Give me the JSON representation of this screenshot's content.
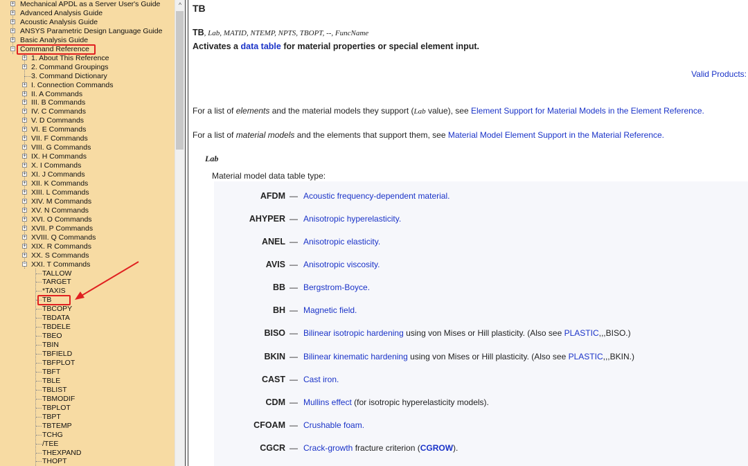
{
  "tree": {
    "items": [
      {
        "label": "Mechanical APDL as a Server User's Guide",
        "level": 0,
        "expander": "+"
      },
      {
        "label": "Advanced Analysis Guide",
        "level": 0,
        "expander": "+"
      },
      {
        "label": "Acoustic Analysis Guide",
        "level": 0,
        "expander": "+"
      },
      {
        "label": "ANSYS Parametric Design Language Guide",
        "level": 0,
        "expander": "+"
      },
      {
        "label": "Basic Analysis Guide",
        "level": 0,
        "expander": "+"
      },
      {
        "label": "Command Reference",
        "level": 0,
        "expander": "-",
        "highlight": true
      },
      {
        "label": "1. About This Reference",
        "level": 1,
        "expander": "+"
      },
      {
        "label": "2. Command Groupings",
        "level": 1,
        "expander": "+"
      },
      {
        "label": "3. Command Dictionary",
        "level": 1,
        "expander": ""
      },
      {
        "label": "I. Connection Commands",
        "level": 1,
        "expander": "+"
      },
      {
        "label": "II. A Commands",
        "level": 1,
        "expander": "+"
      },
      {
        "label": "III. B Commands",
        "level": 1,
        "expander": "+"
      },
      {
        "label": "IV. C Commands",
        "level": 1,
        "expander": "+"
      },
      {
        "label": "V. D Commands",
        "level": 1,
        "expander": "+"
      },
      {
        "label": "VI. E Commands",
        "level": 1,
        "expander": "+"
      },
      {
        "label": "VII. F Commands",
        "level": 1,
        "expander": "+"
      },
      {
        "label": "VIII. G Commands",
        "level": 1,
        "expander": "+"
      },
      {
        "label": "IX. H Commands",
        "level": 1,
        "expander": "+"
      },
      {
        "label": "X. I Commands",
        "level": 1,
        "expander": "+"
      },
      {
        "label": "XI. J Commands",
        "level": 1,
        "expander": "+"
      },
      {
        "label": "XII. K Commands",
        "level": 1,
        "expander": "+"
      },
      {
        "label": "XIII. L Commands",
        "level": 1,
        "expander": "+"
      },
      {
        "label": "XIV. M Commands",
        "level": 1,
        "expander": "+"
      },
      {
        "label": "XV. N Commands",
        "level": 1,
        "expander": "+"
      },
      {
        "label": "XVI. O Commands",
        "level": 1,
        "expander": "+"
      },
      {
        "label": "XVII. P Commands",
        "level": 1,
        "expander": "+"
      },
      {
        "label": "XVIII. Q Commands",
        "level": 1,
        "expander": "+"
      },
      {
        "label": "XIX. R Commands",
        "level": 1,
        "expander": "+"
      },
      {
        "label": "XX. S Commands",
        "level": 1,
        "expander": "+"
      },
      {
        "label": "XXI. T Commands",
        "level": 1,
        "expander": "-"
      },
      {
        "label": "TALLOW",
        "level": 2,
        "expander": ""
      },
      {
        "label": "TARGET",
        "level": 2,
        "expander": ""
      },
      {
        "label": "*TAXIS",
        "level": 2,
        "expander": ""
      },
      {
        "label": "TB",
        "level": 2,
        "expander": "",
        "highlight": true,
        "selected": true
      },
      {
        "label": "TBCOPY",
        "level": 2,
        "expander": ""
      },
      {
        "label": "TBDATA",
        "level": 2,
        "expander": ""
      },
      {
        "label": "TBDELE",
        "level": 2,
        "expander": ""
      },
      {
        "label": "TBEO",
        "level": 2,
        "expander": ""
      },
      {
        "label": "TBIN",
        "level": 2,
        "expander": ""
      },
      {
        "label": "TBFIELD",
        "level": 2,
        "expander": ""
      },
      {
        "label": "TBFPLOT",
        "level": 2,
        "expander": ""
      },
      {
        "label": "TBFT",
        "level": 2,
        "expander": ""
      },
      {
        "label": "TBLE",
        "level": 2,
        "expander": ""
      },
      {
        "label": "TBLIST",
        "level": 2,
        "expander": ""
      },
      {
        "label": "TBMODIF",
        "level": 2,
        "expander": ""
      },
      {
        "label": "TBPLOT",
        "level": 2,
        "expander": ""
      },
      {
        "label": "TBPT",
        "level": 2,
        "expander": ""
      },
      {
        "label": "TBTEMP",
        "level": 2,
        "expander": ""
      },
      {
        "label": "TCHG",
        "level": 2,
        "expander": ""
      },
      {
        "label": "/TEE",
        "level": 2,
        "expander": ""
      },
      {
        "label": "THEXPAND",
        "level": 2,
        "expander": ""
      },
      {
        "label": "THOPT",
        "level": 2,
        "expander": ""
      }
    ]
  },
  "scrollbar": {
    "up_glyph": "^"
  },
  "doc": {
    "title": "TB",
    "syntax_cmd": "TB",
    "syntax_args": ", Lab, MATID, NTEMP, NPTS, TBOPT, --, FuncName",
    "summary_pre": "Activates a ",
    "summary_link": "data table",
    "summary_post": " for material properties or special element input.",
    "valid_products": "Valid Products:",
    "para1_pre": "For a list of ",
    "para1_em": "elements",
    "para1_mid": " and the material models they support (",
    "para1_code": "Lab",
    "para1_post": " value), see ",
    "para1_link": "Element Support for Material Models in the Element Reference.",
    "para2_pre": "For a list of ",
    "para2_em": "material models",
    "para2_mid": " and the elements that support them, see ",
    "para2_link": "Material Model Element Support in the Material Reference.",
    "lab_heading": "Lab",
    "lab_desc": "Material model data table type:",
    "dash": "—",
    "entries": [
      {
        "code": "AFDM",
        "link": "Acoustic frequency-dependent material.",
        "rest": "",
        "link2": "",
        "rest2": ""
      },
      {
        "code": "AHYPER",
        "link": "Anisotropic hyperelasticity.",
        "rest": "",
        "link2": "",
        "rest2": ""
      },
      {
        "code": "ANEL",
        "link": "Anisotropic elasticity.",
        "rest": "",
        "link2": "",
        "rest2": ""
      },
      {
        "code": "AVIS",
        "link": "Anisotropic viscosity.",
        "rest": "",
        "link2": "",
        "rest2": ""
      },
      {
        "code": "BB",
        "link": "Bergstrom-Boyce.",
        "rest": "",
        "link2": "",
        "rest2": ""
      },
      {
        "code": "BH",
        "link": "Magnetic field.",
        "rest": "",
        "link2": "",
        "rest2": ""
      },
      {
        "code": "BISO",
        "link": "Bilinear isotropic hardening",
        "rest": " using von Mises or Hill plasticity. (Also see ",
        "link2": "PLASTIC",
        "rest2": ",,,BISO.)"
      },
      {
        "code": "BKIN",
        "link": "Bilinear kinematic hardening",
        "rest": " using von Mises or Hill plasticity. (Also see ",
        "link2": "PLASTIC",
        "rest2": ",,,BKIN.)"
      },
      {
        "code": "CAST",
        "link": "Cast iron.",
        "rest": "",
        "link2": "",
        "rest2": ""
      },
      {
        "code": "CDM",
        "link": "Mullins effect",
        "rest": " (for isotropic hyperelasticity models).",
        "link2": "",
        "rest2": ""
      },
      {
        "code": "CFOAM",
        "link": "Crushable foam.",
        "rest": "",
        "link2": "",
        "rest2": ""
      },
      {
        "code": "CGCR",
        "link": "Crack-growth",
        "rest": " fracture criterion (",
        "link2": "CGROW",
        "rest2": ")."
      }
    ]
  },
  "colors": {
    "tree_bg": "#f7dba3",
    "link": "#1a33c8",
    "highlight": "#e02020"
  }
}
